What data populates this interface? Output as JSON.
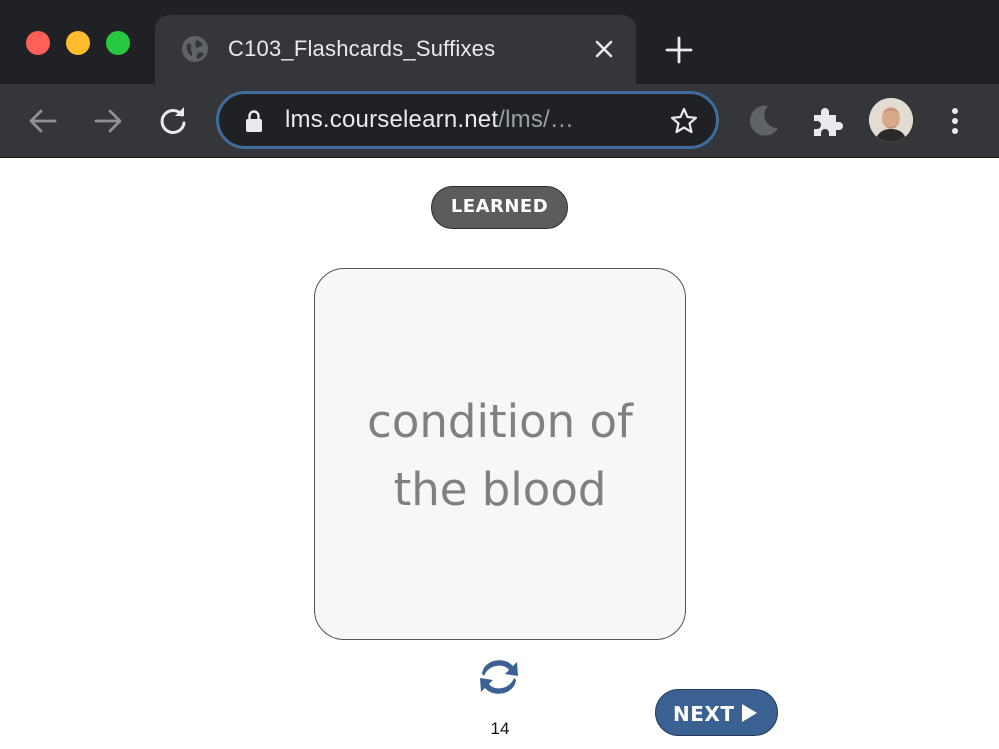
{
  "browser": {
    "tab": {
      "title": "C103_Flashcards_Suffixes",
      "favicon": "globe-icon"
    },
    "address_bar": {
      "host": "lms.courselearn.net",
      "path": "/lms/…"
    },
    "extensions": [
      "moon-icon",
      "puzzle-icon"
    ],
    "colors": {
      "frame": "#202124",
      "toolbar": "#35363a",
      "omnibox_focus": "#3f6c9b"
    }
  },
  "page": {
    "learned_label": "LEARNED",
    "card": {
      "text": "condition of the blood"
    },
    "card_number": "14",
    "next_label": "NEXT",
    "colors": {
      "accent": "#3a6191",
      "learned_bg": "#5c5c5c",
      "card_bg": "#f7f7f7",
      "card_text": "#808080"
    }
  }
}
